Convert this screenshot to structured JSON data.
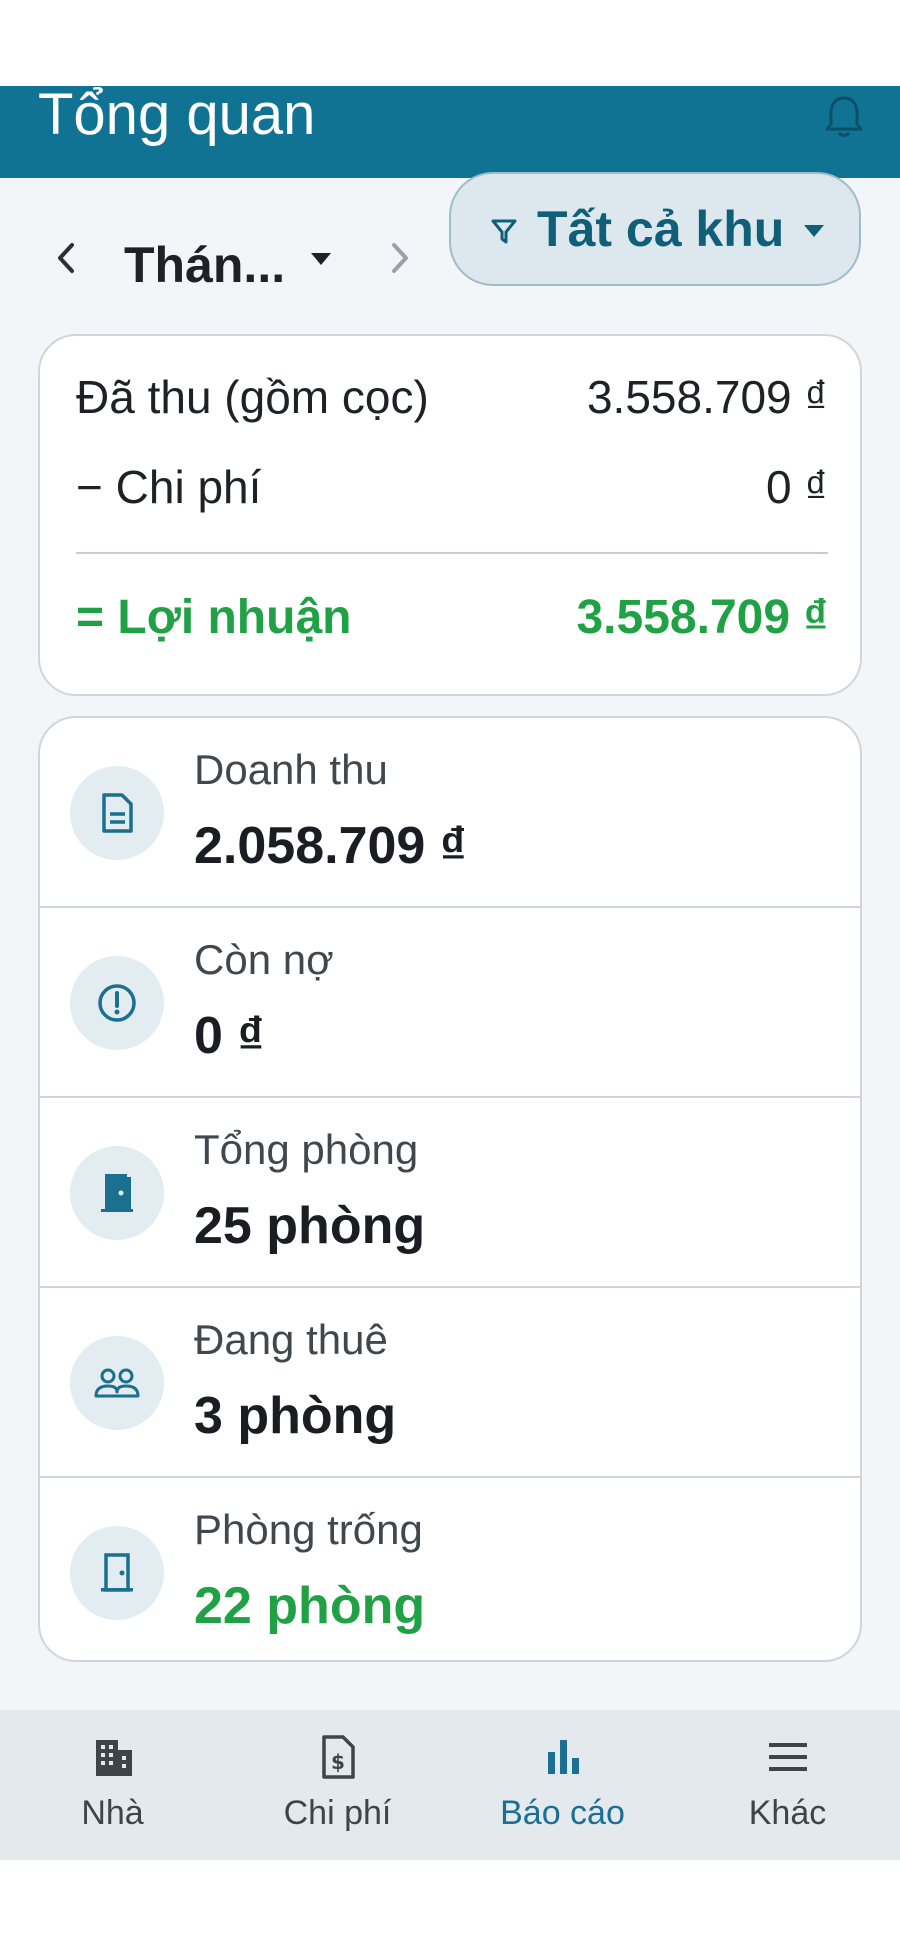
{
  "header": {
    "title": "Tổng quan",
    "notification_icon": "bell-icon"
  },
  "filter": {
    "prev_icon": "chevron-left-icon",
    "month_label": "Thán...",
    "next_icon": "chevron-right-icon",
    "area_label": "Tất cả khu",
    "area_icon": "filter-icon"
  },
  "summary": {
    "collected_label": "Đã thu (gồm cọc)",
    "collected_value": "3.558.709 ₫",
    "expense_label": "− Chi phí",
    "expense_value": "0 ₫",
    "profit_label": "= Lợi nhuận",
    "profit_value": "3.558.709 ₫"
  },
  "stats": [
    {
      "label": "Doanh thu",
      "value": "2.058.709 ₫",
      "icon": "document-icon"
    },
    {
      "label": "Còn nợ",
      "value": "0 ₫",
      "icon": "alert-circle-icon"
    },
    {
      "label": "Tổng phòng",
      "value": "25 phòng",
      "icon": "door-open-icon"
    },
    {
      "label": "Đang thuê",
      "value": "3 phòng",
      "icon": "people-icon"
    },
    {
      "label": "Phòng trống",
      "value": "22 phòng",
      "icon": "door-closed-icon"
    }
  ],
  "nav": [
    {
      "label": "Nhà",
      "icon": "building-icon",
      "active": false
    },
    {
      "label": "Chi phí",
      "icon": "receipt-icon",
      "active": false
    },
    {
      "label": "Báo cáo",
      "icon": "bar-chart-icon",
      "active": true
    },
    {
      "label": "Khác",
      "icon": "menu-icon",
      "active": false
    }
  ],
  "colors": {
    "header_bg": "#117394",
    "accent": "#1a6f93",
    "positive": "#21a145",
    "icon_color": "#1b6f8f"
  }
}
